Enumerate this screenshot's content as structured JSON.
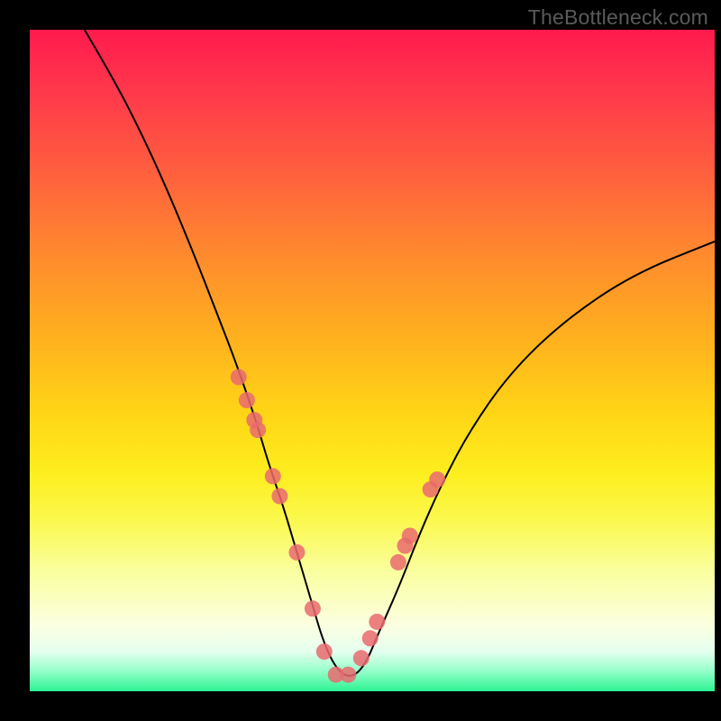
{
  "watermark": "TheBottleneck.com",
  "colors": {
    "frame": "#000000",
    "marker": "#e96a6e",
    "watermark_text": "#5a5a5a"
  },
  "chart_data": {
    "type": "line",
    "title": "",
    "xlabel": "",
    "ylabel": "",
    "xlim": [
      0,
      100
    ],
    "ylim": [
      0,
      100
    ],
    "grid": false,
    "legend": false,
    "notes": "No axis ticks or numeric labels are rendered; values are proportional (0–100) inferred from gridless plot area. Curve is a V-shaped bottleneck profile with minimum near x≈44. Markers cluster along the lower portion of the curve.",
    "series": [
      {
        "name": "curve",
        "x": [
          8,
          12,
          16,
          20,
          24,
          27,
          30,
          33,
          35,
          37,
          39,
          41,
          43,
          45,
          47,
          49,
          51,
          54,
          57,
          60,
          64,
          70,
          78,
          88,
          100
        ],
        "y": [
          100,
          93,
          85,
          76,
          66,
          58,
          50,
          41,
          34,
          28,
          21,
          14,
          7,
          3,
          2,
          4,
          9,
          16,
          24,
          31,
          39,
          48,
          56,
          63,
          68
        ]
      }
    ],
    "markers": {
      "name": "highlighted-points",
      "x": [
        30.5,
        31.7,
        32.8,
        33.3,
        35.5,
        36.5,
        39.0,
        41.3,
        43.0,
        44.7,
        46.5,
        48.4,
        49.7,
        50.7,
        53.8,
        54.8,
        55.5,
        58.5,
        59.5
      ],
      "y": [
        47.5,
        44.0,
        41.0,
        39.5,
        32.5,
        29.5,
        21.0,
        12.5,
        6.0,
        2.5,
        2.5,
        5.0,
        8.0,
        10.5,
        19.5,
        22.0,
        23.5,
        30.5,
        32.0
      ]
    }
  }
}
